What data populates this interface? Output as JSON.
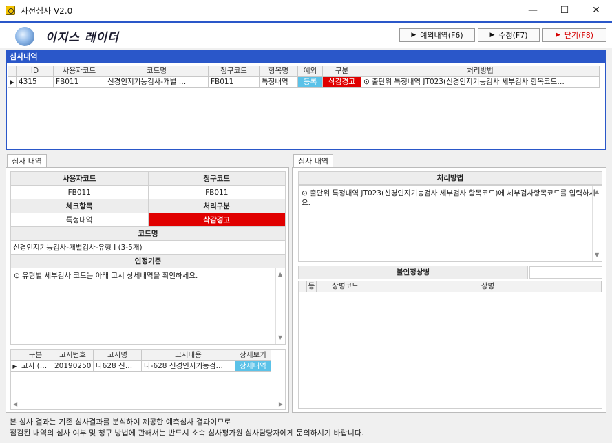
{
  "window": {
    "title": "사전심사 V2.0",
    "minimize": "—",
    "maximize": "☐",
    "close": "✕"
  },
  "header": {
    "logo_text": "이지스 레이더",
    "buttons": {
      "except_list": "예외내역(F6)",
      "edit": "수정(F7)",
      "close": "닫기(F8)"
    },
    "accent_color": "#2a57c9"
  },
  "review_list": {
    "title": "심사내역",
    "columns": [
      "ID",
      "사용자코드",
      "코드명",
      "청구코드",
      "항목명",
      "예외",
      "구분",
      "처리방법"
    ],
    "rows": [
      {
        "id": "4315",
        "user_code": "FB011",
        "code_name": "신경인지기능검사-개별 …",
        "claim_code": "FB011",
        "item_name": "특정내역",
        "exception": "등록",
        "category": "삭감경고",
        "method": "⊙ 출단위 특정내역 JT023(신경인지기능검사 세부검사 항목코드…"
      }
    ]
  },
  "left_panel": {
    "tab": "심사 내역",
    "user_code_label": "사용자코드",
    "claim_code_label": "청구코드",
    "user_code": "FB011",
    "claim_code": "FB011",
    "check_item_label": "체크항목",
    "process_label": "처리구분",
    "check_item": "특정내역",
    "process": "삭감경고",
    "code_name_label": "코드명",
    "code_name": "신경인지기능검사-개별검사-유형 I (3-5개)",
    "criteria_label": "인정기준",
    "criteria_text": "⊙ 유형별 세부검사 코드는 아래 고시 상세내역을 확인하세요.",
    "notice_columns": [
      "구분",
      "고시번호",
      "고시명",
      "고시내용",
      "상세보기"
    ],
    "notice_rows": [
      {
        "type": "고시 (…",
        "number": "20190250",
        "name": "나628 신…",
        "content": "나-628 신경인지기능검…",
        "detail": "상세내역"
      }
    ]
  },
  "right_panel": {
    "tab": "심사 내역",
    "method_label": "처리방법",
    "method_text": "⊙ 출단위 특정내역 JT023(신경인지기능검사 세부검사 항목코드)에 세부검사항목코드를 입력하세요.",
    "disease_label": "불인정상병",
    "disease_columns": [
      "등",
      "상병코드",
      "상병"
    ]
  },
  "footer": {
    "line1": "본 심사 결과는 기존 심사결과를 분석하여 제공한 예측심사 결과이므로",
    "line2": "점검된 내역의 심사 여부 및 청구 방법에 관해서는 반드시 소속 심사평가원 심사담당자에게 문의하시기 바랍니다."
  }
}
